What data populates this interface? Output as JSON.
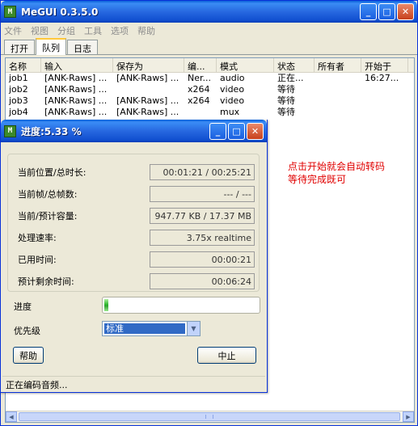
{
  "main": {
    "title": "MeGUI 0.3.5.0",
    "app_icon": "M",
    "menu": [
      "文件",
      "视图",
      "分组",
      "工具",
      "选项",
      "帮助"
    ],
    "tabs": [
      "打开",
      "队列",
      "日志"
    ],
    "columns": [
      "名称",
      "输入",
      "保存为",
      "编...",
      "模式",
      "状态",
      "所有者",
      "开始于"
    ],
    "rows": [
      [
        "job1",
        "[ANK-Raws] ...",
        "[ANK-Raws] ...",
        "Ner...",
        "audio",
        "正在...",
        "",
        "16:27..."
      ],
      [
        "job2",
        "[ANK-Raws] ...",
        "",
        "x264",
        "video",
        "等待",
        "",
        ""
      ],
      [
        "job3",
        "[ANK-Raws] ...",
        "[ANK-Raws] ...",
        "x264",
        "video",
        "等待",
        "",
        ""
      ],
      [
        "job4",
        "[ANK-Raws] ...",
        "[ANK-Raws] ...",
        "",
        "mux",
        "等待",
        "",
        ""
      ]
    ]
  },
  "annotation": {
    "line1": "点击开始就会自动转码",
    "line2": "等待完成既可"
  },
  "dialog": {
    "title": "进度:5.33 %",
    "info": [
      {
        "label": "当前位置/总时长:",
        "value": "00:01:21 / 00:25:21"
      },
      {
        "label": "当前帧/总帧数:",
        "value": "--- / ---"
      },
      {
        "label": "当前/预计容量:",
        "value": "947.77 KB / 17.37 MB"
      },
      {
        "label": "处理速率:",
        "value": "3.75x realtime"
      },
      {
        "label": "已用时间:",
        "value": "00:00:21"
      },
      {
        "label": "预计剩余时间:",
        "value": "00:06:24"
      }
    ],
    "progress_label": "进度",
    "progress_percent": 5.33,
    "priority_label": "优先级",
    "priority_value": "标准",
    "help_button": "帮助",
    "abort_button": "中止",
    "status_text": "正在编码音频..."
  },
  "colors": {
    "titlebar": "#2768e0",
    "annotation": "#e00000",
    "progress": "#2fb82f"
  }
}
